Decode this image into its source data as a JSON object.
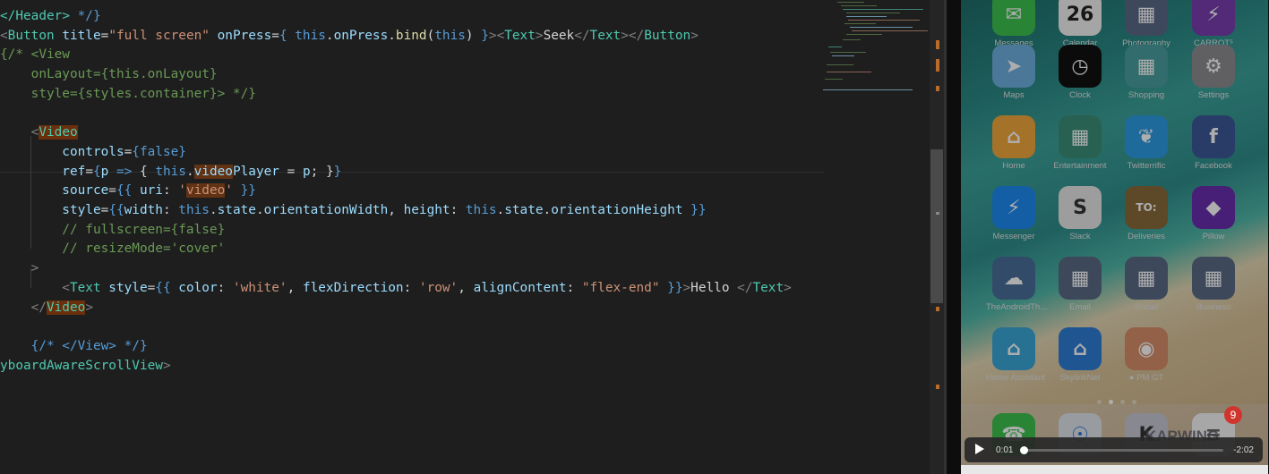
{
  "editor": {
    "lines": [
      [
        {
          "t": "</",
          "c": "t-tag"
        },
        {
          "t": "Header",
          "c": "t-tag"
        },
        {
          "t": "> ",
          "c": "t-tag"
        },
        {
          "t": "*/}",
          "c": "t-kw"
        }
      ],
      [
        {
          "t": "<",
          "c": "t-punc"
        },
        {
          "t": "Button",
          "c": "t-tag"
        },
        {
          "t": " title",
          "c": "t-attr"
        },
        {
          "t": "=",
          "c": "t-txt"
        },
        {
          "t": "\"full screen\"",
          "c": "t-str"
        },
        {
          "t": " onPress",
          "c": "t-attr"
        },
        {
          "t": "=",
          "c": "t-txt"
        },
        {
          "t": "{ ",
          "c": "t-kw"
        },
        {
          "t": "this",
          "c": "t-kw"
        },
        {
          "t": ".",
          "c": "t-txt"
        },
        {
          "t": "onPress",
          "c": "t-attr"
        },
        {
          "t": ".",
          "c": "t-txt"
        },
        {
          "t": "bind",
          "c": "t-fn"
        },
        {
          "t": "(",
          "c": "t-txt"
        },
        {
          "t": "this",
          "c": "t-kw"
        },
        {
          "t": ") ",
          "c": "t-txt"
        },
        {
          "t": "}",
          "c": "t-kw"
        },
        {
          "t": "><",
          "c": "t-punc"
        },
        {
          "t": "Text",
          "c": "t-tag"
        },
        {
          "t": ">",
          "c": "t-punc"
        },
        {
          "t": "Seek",
          "c": "t-txt"
        },
        {
          "t": "</",
          "c": "t-punc"
        },
        {
          "t": "Text",
          "c": "t-tag"
        },
        {
          "t": "></",
          "c": "t-punc"
        },
        {
          "t": "Button",
          "c": "t-tag"
        },
        {
          "t": ">",
          "c": "t-punc"
        }
      ],
      [
        {
          "t": "{/* <View",
          "c": "t-com"
        }
      ],
      [
        {
          "t": "    onLayout={this.onLayout}",
          "c": "t-com"
        }
      ],
      [
        {
          "t": "    style={styles.container}> */}",
          "c": "t-com"
        }
      ],
      [],
      [
        {
          "t": "    <",
          "c": "t-punc"
        },
        {
          "t": "Video",
          "c": "t-tag hl"
        }
      ],
      [
        {
          "t": "        controls",
          "c": "t-attr"
        },
        {
          "t": "=",
          "c": "t-txt"
        },
        {
          "t": "{false}",
          "c": "t-kw"
        }
      ],
      [
        {
          "t": "        ref",
          "c": "t-attr"
        },
        {
          "t": "=",
          "c": "t-txt"
        },
        {
          "t": "{",
          "c": "t-kw"
        },
        {
          "t": "p",
          "c": "t-attr"
        },
        {
          "t": " => ",
          "c": "t-kw"
        },
        {
          "t": "{ ",
          "c": "t-txt"
        },
        {
          "t": "this",
          "c": "t-kw"
        },
        {
          "t": ".",
          "c": "t-txt"
        },
        {
          "t": "video",
          "c": "t-attr hl2"
        },
        {
          "t": "Player",
          "c": "t-attr"
        },
        {
          "t": " = ",
          "c": "t-txt"
        },
        {
          "t": "p",
          "c": "t-attr"
        },
        {
          "t": "; ",
          "c": "t-txt"
        },
        {
          "t": "}",
          "c": "t-txt"
        },
        {
          "t": "}",
          "c": "t-kw"
        }
      ],
      [
        {
          "t": "        source",
          "c": "t-attr"
        },
        {
          "t": "=",
          "c": "t-txt"
        },
        {
          "t": "{{ ",
          "c": "t-kw"
        },
        {
          "t": "uri",
          "c": "t-attr"
        },
        {
          "t": ": ",
          "c": "t-txt"
        },
        {
          "t": "'",
          "c": "t-str"
        },
        {
          "t": "video",
          "c": "t-str hl2"
        },
        {
          "t": "'",
          "c": "t-str"
        },
        {
          "t": " }}",
          "c": "t-kw"
        }
      ],
      [
        {
          "t": "        style",
          "c": "t-attr"
        },
        {
          "t": "=",
          "c": "t-txt"
        },
        {
          "t": "{{",
          "c": "t-kw"
        },
        {
          "t": "width",
          "c": "t-attr"
        },
        {
          "t": ": ",
          "c": "t-txt"
        },
        {
          "t": "this",
          "c": "t-kw"
        },
        {
          "t": ".",
          "c": "t-txt"
        },
        {
          "t": "state",
          "c": "t-attr"
        },
        {
          "t": ".",
          "c": "t-txt"
        },
        {
          "t": "orientationWidth",
          "c": "t-attr"
        },
        {
          "t": ", ",
          "c": "t-txt"
        },
        {
          "t": "height",
          "c": "t-attr"
        },
        {
          "t": ": ",
          "c": "t-txt"
        },
        {
          "t": "this",
          "c": "t-kw"
        },
        {
          "t": ".",
          "c": "t-txt"
        },
        {
          "t": "state",
          "c": "t-attr"
        },
        {
          "t": ".",
          "c": "t-txt"
        },
        {
          "t": "orientationHeight",
          "c": "t-attr"
        },
        {
          "t": " }}",
          "c": "t-kw"
        }
      ],
      [
        {
          "t": "        // fullscreen={false}",
          "c": "t-com"
        }
      ],
      [
        {
          "t": "        // resizeMode='cover'",
          "c": "t-com"
        }
      ],
      [
        {
          "t": "    >",
          "c": "t-punc"
        }
      ],
      [
        {
          "t": "        <",
          "c": "t-punc"
        },
        {
          "t": "Text",
          "c": "t-tag"
        },
        {
          "t": " style",
          "c": "t-attr"
        },
        {
          "t": "=",
          "c": "t-txt"
        },
        {
          "t": "{{ ",
          "c": "t-kw"
        },
        {
          "t": "color",
          "c": "t-attr"
        },
        {
          "t": ": ",
          "c": "t-txt"
        },
        {
          "t": "'white'",
          "c": "t-str"
        },
        {
          "t": ", ",
          "c": "t-txt"
        },
        {
          "t": "flexDirection",
          "c": "t-attr"
        },
        {
          "t": ": ",
          "c": "t-txt"
        },
        {
          "t": "'row'",
          "c": "t-str"
        },
        {
          "t": ", ",
          "c": "t-txt"
        },
        {
          "t": "alignContent",
          "c": "t-attr"
        },
        {
          "t": ": ",
          "c": "t-txt"
        },
        {
          "t": "\"flex-end\"",
          "c": "t-str"
        },
        {
          "t": " }}",
          "c": "t-kw"
        },
        {
          "t": ">",
          "c": "t-punc"
        },
        {
          "t": "Hello ",
          "c": "t-txt"
        },
        {
          "t": "</",
          "c": "t-punc"
        },
        {
          "t": "Text",
          "c": "t-tag"
        },
        {
          "t": ">",
          "c": "t-punc"
        }
      ],
      [
        {
          "t": "    </",
          "c": "t-punc"
        },
        {
          "t": "Video",
          "c": "t-tag hl"
        },
        {
          "t": ">",
          "c": "t-punc"
        }
      ],
      [],
      [
        {
          "t": "    {/* </View> */}",
          "c": "t-kw"
        }
      ],
      [
        {
          "t": "yboardAwareScrollView",
          "c": "t-tag"
        },
        {
          "t": ">",
          "c": "t-punc"
        }
      ]
    ]
  },
  "home_screen": {
    "apps": [
      {
        "label": "Messages",
        "color": "#3ec34f",
        "glyph": "✉"
      },
      {
        "label": "Calendar",
        "color": "#f4f4f4",
        "glyph": "26",
        "glyph_color": "#222"
      },
      {
        "label": "Photography",
        "color": "#5a6a8a",
        "glyph": "▦"
      },
      {
        "label": "CARROT⁵",
        "color": "#7a3fb0",
        "glyph": "⚡"
      },
      {
        "label": "Maps",
        "color": "#6fb0e0",
        "glyph": "➤"
      },
      {
        "label": "Clock",
        "color": "#111111",
        "glyph": "◷"
      },
      {
        "label": "Shopping",
        "color": "#4aa0a0",
        "glyph": "▦"
      },
      {
        "label": "Settings",
        "color": "#8e8e93",
        "glyph": "⚙"
      },
      {
        "label": "Home",
        "color": "#f2a93b",
        "glyph": "⌂"
      },
      {
        "label": "Entertainment",
        "color": "#3b8f7a",
        "glyph": "▦"
      },
      {
        "label": "Twitterrific",
        "color": "#2d9ce3",
        "glyph": "❦"
      },
      {
        "label": "Facebook",
        "color": "#3b5998",
        "glyph": "f"
      },
      {
        "label": "Messenger",
        "color": "#1c8bf2",
        "glyph": "⚡"
      },
      {
        "label": "Slack",
        "color": "#e8e8e8",
        "glyph": "S",
        "glyph_color": "#333"
      },
      {
        "label": "Deliveries",
        "color": "#8a6a3a",
        "glyph": "TO:"
      },
      {
        "label": "Pillow",
        "color": "#6b2fb0",
        "glyph": "◆"
      },
      {
        "label": "TheAndroidTh...",
        "color": "#4a6f9a",
        "glyph": "☁"
      },
      {
        "label": "Email",
        "color": "#5a6b86",
        "glyph": "▦"
      },
      {
        "label": "Social",
        "color": "#5a6b86",
        "glyph": "▦"
      },
      {
        "label": "Business",
        "color": "#5a6b86",
        "glyph": "▦"
      },
      {
        "label": "Home Assistant",
        "color": "#3aa7d8",
        "glyph": "⌂"
      },
      {
        "label": "SkylinkNet",
        "color": "#2f7fd8",
        "glyph": "⌂"
      },
      {
        "label": "● PM GT",
        "color": "#d9906a",
        "glyph": "◉"
      }
    ],
    "dock": [
      {
        "label": "Phone",
        "color": "#3ec34f",
        "glyph": "☎"
      },
      {
        "label": "Safari",
        "color": "#e0e6ee",
        "glyph": "☉",
        "glyph_color": "#2b74d8"
      },
      {
        "label": "Kapwing",
        "color": "#c9c9d6",
        "glyph": "K",
        "glyph_color": "#333"
      },
      {
        "label": "Notes",
        "color": "#f6f6f6",
        "glyph": "≡",
        "glyph_color": "#666"
      }
    ],
    "badge": "9",
    "watermark": "KAPWING"
  },
  "player": {
    "elapsed": "0:01",
    "remaining": "-2:02",
    "progress": 0.01
  }
}
